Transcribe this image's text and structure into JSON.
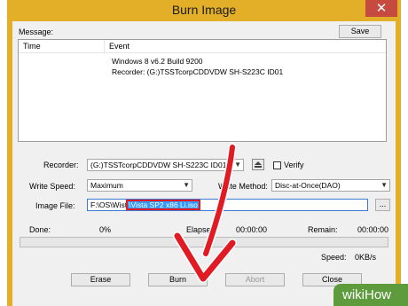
{
  "window": {
    "title": "Burn Image",
    "close_glyph": "✕"
  },
  "message": {
    "label": "Message:",
    "save_label": "Save",
    "columns": [
      "Time",
      "Event"
    ],
    "events": [
      "Windows 8 v6.2 Build 9200",
      "Recorder: (G:)TSSTcorpCDDVDW SH-S223C ID01"
    ]
  },
  "recorder": {
    "label": "Recorder:",
    "value": "(G:)TSSTcorpCDDVDW SH-S223C ID01",
    "verify_label": "Verify",
    "verify_checked": false
  },
  "write_speed": {
    "label": "Write Speed:",
    "value": "Maximum"
  },
  "write_method": {
    "label": "Write Method:",
    "value": "Disc-at-Once(DAO)"
  },
  "image_file": {
    "label": "Image File:",
    "value_prefix": "F:\\OS\\Wist",
    "value_selected": "\\Vista SP2 x86 Li.iso",
    "browse_label": "..."
  },
  "status": {
    "done_label": "Done:",
    "done_value": "0%",
    "elapsed_label": "Elapsed:",
    "elapsed_value": "00:00:00",
    "remain_label": "Remain:",
    "remain_value": "00:00:00",
    "speed_label": "Speed:",
    "speed_value": "0KB/s",
    "progress_fraction": 0
  },
  "buttons": {
    "erase": "Erase",
    "burn": "Burn",
    "abort": "Abort",
    "close": "Close"
  },
  "watermark": {
    "text": "wikiHow"
  },
  "colors": {
    "title_bar": "#e3ae28",
    "annotation_arrow": "#e01b24",
    "selection": "#3399ff",
    "close_button": "#c74a41",
    "badge": "#5e9b3c"
  },
  "icons": {
    "eject": "eject-icon",
    "arrow": "red-arrow-annotation"
  }
}
